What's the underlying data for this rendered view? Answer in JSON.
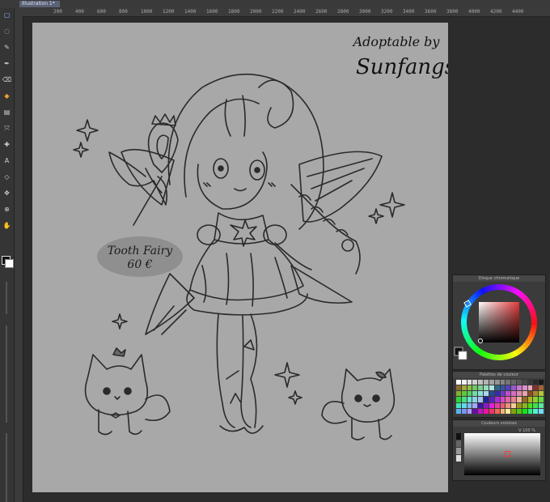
{
  "document": {
    "tab_label": "Illustration 1*"
  },
  "ruler": {
    "ticks": [
      "200",
      "400",
      "600",
      "800",
      "1000",
      "1200",
      "1400",
      "1600",
      "1800",
      "2000",
      "2200",
      "2400",
      "2600",
      "2800",
      "3000",
      "3200",
      "3400",
      "3600",
      "3800",
      "4000",
      "4200",
      "4400"
    ]
  },
  "canvas": {
    "title_line_1": "Adoptable by",
    "title_line_2": "Sunfangs",
    "price_name": "Tooth Fairy",
    "price_value": "60 €"
  },
  "panels": {
    "wheel_title": "Disque chromatique",
    "palette_title": "Palettes de couleur",
    "mixer_title": "Couleurs voisines",
    "mixer_value": "V 100 %"
  },
  "tools": [
    "select-icon",
    "lasso-icon",
    "brush-icon",
    "pen-icon",
    "eraser-icon",
    "fill-icon",
    "gradient-icon",
    "transform-icon",
    "eyedropper-icon",
    "text-icon",
    "shape-icon",
    "move-icon",
    "zoom-icon",
    "hand-icon"
  ],
  "colors": {
    "wheel_hue": "#e33a3a",
    "foreground": "#111111",
    "background": "#ffffff"
  }
}
